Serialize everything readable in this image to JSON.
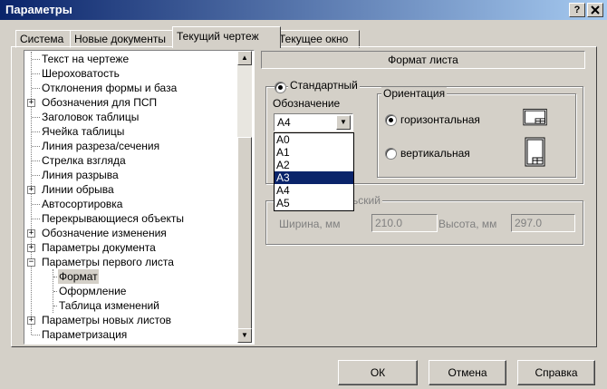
{
  "window": {
    "title": "Параметры",
    "help_btn": "?",
    "close_btn": "X"
  },
  "tabs": [
    {
      "label": "Система"
    },
    {
      "label": "Новые документы"
    },
    {
      "label": "Текущий чертеж"
    },
    {
      "label": "Текущее окно"
    }
  ],
  "tree": {
    "items": [
      {
        "label": "Текст на чертеже"
      },
      {
        "label": "Шероховатость"
      },
      {
        "label": "Отклонения формы и база"
      },
      {
        "label": "Обозначения для ПСП"
      },
      {
        "label": "Заголовок таблицы"
      },
      {
        "label": "Ячейка таблицы"
      },
      {
        "label": "Линия разреза/сечения"
      },
      {
        "label": "Стрелка взгляда"
      },
      {
        "label": "Линия разрыва"
      },
      {
        "label": "Линии обрыва"
      },
      {
        "label": "Автосортировка"
      },
      {
        "label": "Перекрывающиеся объекты"
      },
      {
        "label": "Обозначение изменения"
      },
      {
        "label": "Параметры документа"
      },
      {
        "label": "Параметры первого листа"
      },
      {
        "label": "Формат"
      },
      {
        "label": "Оформление"
      },
      {
        "label": "Таблица изменений"
      },
      {
        "label": "Параметры новых листов"
      },
      {
        "label": "Параметризация"
      }
    ],
    "expand_plus": "+",
    "expand_minus": "−"
  },
  "panel": {
    "header": "Формат листа",
    "standard_radio": "Стандартный",
    "designation_label": "Обозначение",
    "designation_value": "А4",
    "dropdown_options": [
      "А0",
      "А1",
      "А2",
      "А3",
      "А4",
      "А5"
    ],
    "orientation_title": "Ориентация",
    "horizontal": "горизонтальная",
    "vertical": "вертикальная",
    "custom_title_partial": "льский",
    "width_label": "Ширина, мм",
    "width_value": "210.0",
    "height_label": "Высота, мм",
    "height_value": "297.0"
  },
  "buttons": {
    "ok": "ОК",
    "cancel": "Отмена",
    "help": "Справка"
  },
  "colors": {
    "dialog_bg": "#d4d0c8",
    "titlebar_start": "#0a246a",
    "titlebar_end": "#a6caf0",
    "selection": "#0a246a"
  }
}
